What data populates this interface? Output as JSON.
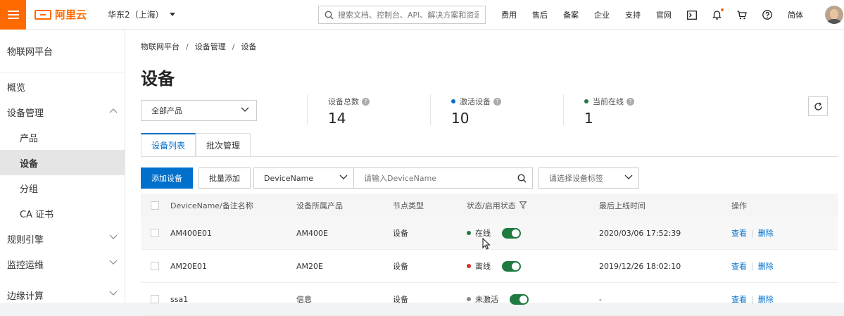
{
  "topbar": {
    "brand": "阿里云",
    "region": "华东2（上海）",
    "search_placeholder": "搜索文档、控制台、API、解决方案和资源",
    "nav": [
      "费用",
      "售后",
      "备案",
      "企业",
      "支持",
      "官网"
    ],
    "lang": "简体",
    "accent": "#ff6a00"
  },
  "sidebar": {
    "title": "物联网平台",
    "items": [
      {
        "label": "概览"
      },
      {
        "label": "设备管理"
      },
      {
        "label": "产品"
      },
      {
        "label": "设备"
      },
      {
        "label": "分组"
      },
      {
        "label": "CA 证书"
      },
      {
        "label": "规则引擎"
      },
      {
        "label": "监控运维"
      },
      {
        "label": "边缘计算"
      }
    ]
  },
  "breadcrumb": [
    "物联网平台",
    "设备管理",
    "设备"
  ],
  "page_title": "设备",
  "filter": {
    "product": "全部产品"
  },
  "stats": {
    "total": {
      "label": "设备总数",
      "value": "14"
    },
    "activated": {
      "label": "激活设备",
      "value": "10",
      "dot_color": "#0070cc"
    },
    "online": {
      "label": "当前在线",
      "value": "1",
      "dot_color": "#1e7a3f"
    }
  },
  "tabs": [
    "设备列表",
    "批次管理"
  ],
  "toolbar": {
    "add": "添加设备",
    "batch_add": "批量添加",
    "field": "DeviceName",
    "input_placeholder": "请输入DeviceName",
    "tag_placeholder": "请选择设备标签"
  },
  "table": {
    "headers": [
      "DeviceName/备注名称",
      "设备所属产品",
      "节点类型",
      "状态/启用状态",
      "最后上线时间",
      "操作"
    ],
    "rows": [
      {
        "name": "AM400E01",
        "product": "AM400E",
        "node": "设备",
        "status": "在线",
        "status_color": "#1e7a3f",
        "last": "2020/03/06 17:52:39",
        "view": "查看",
        "del": "删除"
      },
      {
        "name": "AM20E01",
        "product": "AM20E",
        "node": "设备",
        "status": "离线",
        "status_color": "#d93026",
        "last": "2019/12/26 18:02:10",
        "view": "查看",
        "del": "删除"
      },
      {
        "name": "ssa1",
        "product": "信息",
        "node": "设备",
        "status": "未激活",
        "status_color": "#888888",
        "last": "-",
        "view": "查看",
        "del": "删除"
      }
    ]
  }
}
